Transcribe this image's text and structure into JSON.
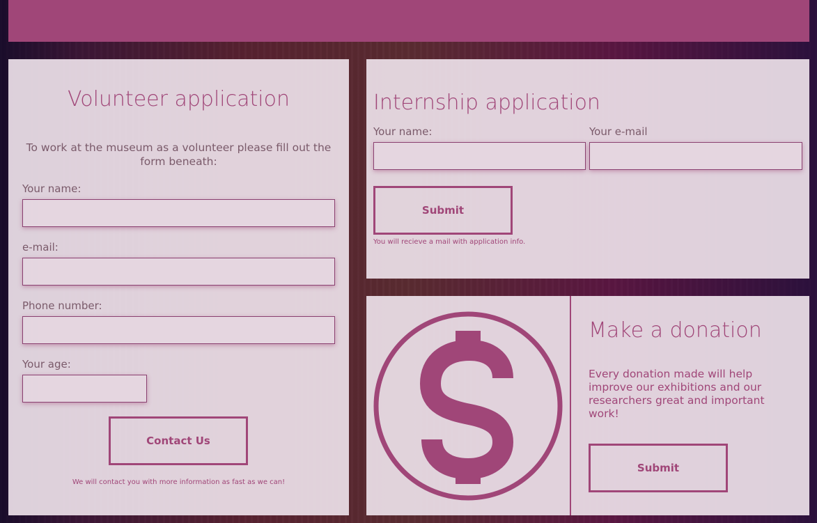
{
  "colors": {
    "accent": "#a04678",
    "panel": "#ece0e8"
  },
  "volunteer": {
    "title": "Volunteer application",
    "intro": "To work at the museum as a volunteer please fill out the form beneath:",
    "name_label": "Your name:",
    "email_label": "e-mail:",
    "phone_label": "Phone number:",
    "age_label": "Your age:",
    "name_value": "",
    "email_value": "",
    "phone_value": "",
    "age_value": "",
    "button_label": "Contact Us",
    "note": "We will contact you with more information as fast as we can!"
  },
  "internship": {
    "title": "Internship application",
    "name_label": "Your name:",
    "email_label": "Your e-mail",
    "name_value": "",
    "email_value": "",
    "button_label": "Submit",
    "note": "You will recieve a mail with application info."
  },
  "donation": {
    "icon": "dollar-circle-icon",
    "title": "Make a donation",
    "text": "Every donation made will help improve our exhibitions and our researchers great and important work!",
    "button_label": "Submit"
  }
}
